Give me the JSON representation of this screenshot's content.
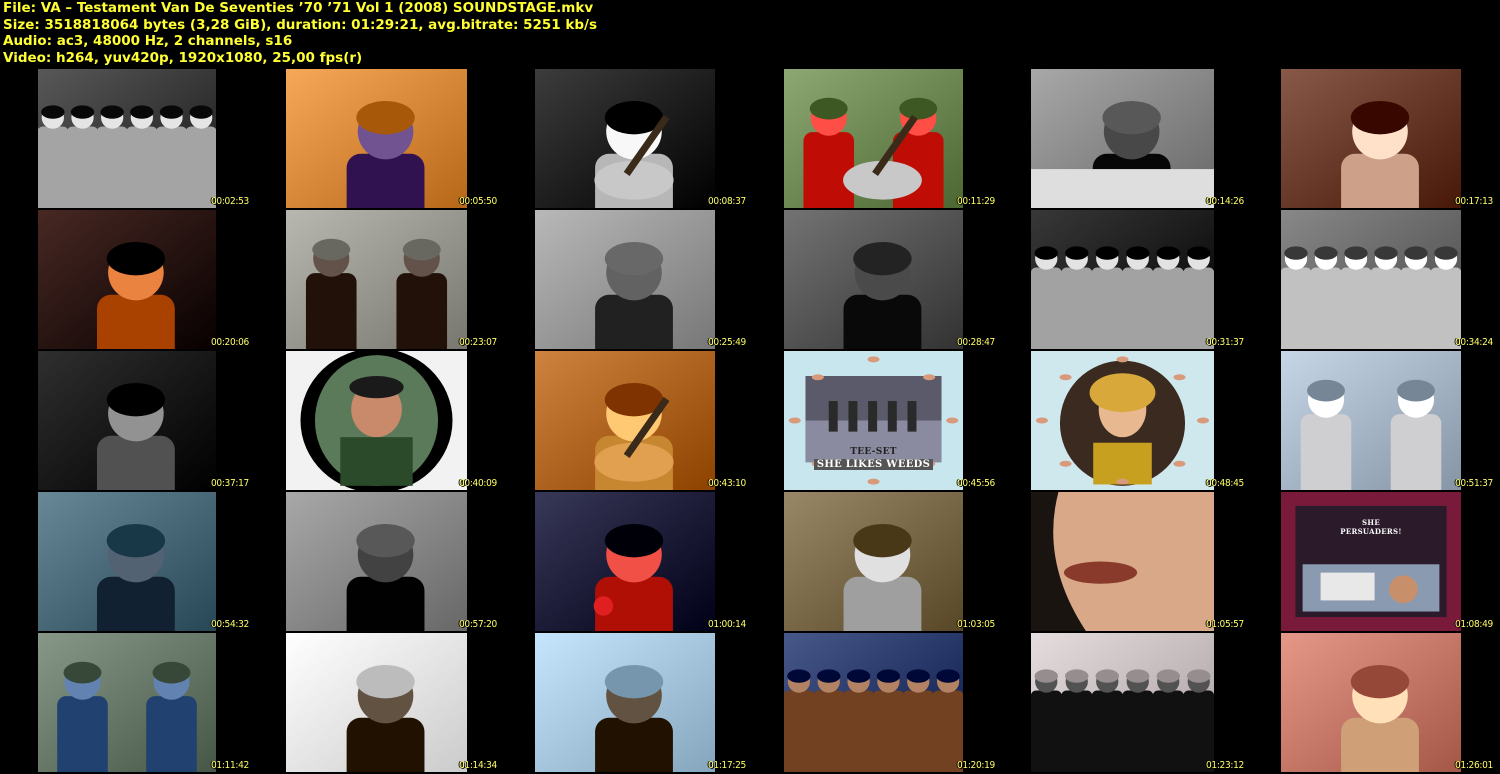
{
  "header": {
    "file_line": "File: VA – Testament Van De Seventies ’70 ’71 Vol 1 (2008) SOUNDSTAGE.mkv",
    "size_line": "Size: 3518818064 bytes (3,28 GiB), duration: 01:29:21, avg.bitrate: 5251 kb/s",
    "audio_line": "Audio: ac3, 48000 Hz, 2 channels, s16",
    "video_line": "Video: h264, yuv420p, 1920x1080, 25,00 fps(r)"
  },
  "thumbnails": [
    {
      "timestamp": "00:02:53",
      "bg": "#3a3a3a",
      "fg": "#bdbdbd",
      "kind": "dancers-bw"
    },
    {
      "timestamp": "00:05:50",
      "bg": "#d98a3a",
      "fg": "#4a2b6a",
      "kind": "organ-color"
    },
    {
      "timestamp": "00:08:37",
      "bg": "#1e1e1e",
      "fg": "#d0d0d0",
      "kind": "guitarist-bw"
    },
    {
      "timestamp": "00:11:29",
      "bg": "#6f8a55",
      "fg": "#d8261e",
      "kind": "duo-red"
    },
    {
      "timestamp": "00:14:26",
      "bg": "#8a8a8a",
      "fg": "#202020",
      "kind": "newsreader-bw"
    },
    {
      "timestamp": "00:17:13",
      "bg": "#6a3a2a",
      "fg": "#e6b9a2",
      "kind": "woman-color"
    },
    {
      "timestamp": "00:20:06",
      "bg": "#2a0a05",
      "fg": "#c25a18",
      "kind": "drummer-color"
    },
    {
      "timestamp": "00:23:07",
      "bg": "#9a9a92",
      "fg": "#3a2a22",
      "kind": "duo-street"
    },
    {
      "timestamp": "00:25:49",
      "bg": "#9a9a9a",
      "fg": "#3a3a3a",
      "kind": "harmonica-bw"
    },
    {
      "timestamp": "00:28:47",
      "bg": "#555555",
      "fg": "#222222",
      "kind": "arch-bw"
    },
    {
      "timestamp": "00:31:37",
      "bg": "#1a1a1a",
      "fg": "#bbbbbb",
      "kind": "crowd-dark"
    },
    {
      "timestamp": "00:34:24",
      "bg": "#6a6a6a",
      "fg": "#dadada",
      "kind": "crowd-bw"
    },
    {
      "timestamp": "00:37:17",
      "bg": "#111111",
      "fg": "#6a6a6a",
      "kind": "singer-dark"
    },
    {
      "timestamp": "00:40:09",
      "bg": "#f4f4f4",
      "fg": "#4a6a4a",
      "kind": "oval-portrait"
    },
    {
      "timestamp": "00:43:10",
      "bg": "#b06520",
      "fg": "#e0a04a",
      "kind": "acoustic-guitar"
    },
    {
      "timestamp": "00:45:56",
      "bg": "#c8e6ee",
      "fg": "#3a3a3a",
      "kind": "band-card",
      "caption_top": "TEE-SET",
      "caption_bottom": "SHE LIKES WEEDS"
    },
    {
      "timestamp": "00:48:45",
      "bg": "#cfe8ee",
      "fg": "#d9a83a",
      "kind": "circle-singer"
    },
    {
      "timestamp": "00:51:37",
      "bg": "#a8b8c8",
      "fg": "#e8e8ea",
      "kind": "sailors"
    },
    {
      "timestamp": "00:54:32",
      "bg": "#4a6a7a",
      "fg": "#2a3a4a",
      "kind": "water-boats"
    },
    {
      "timestamp": "00:57:20",
      "bg": "#8a8a8a",
      "fg": "#1a1a1a",
      "kind": "man-suit-bw"
    },
    {
      "timestamp": "01:00:14",
      "bg": "#1a1a3a",
      "fg": "#c8281e",
      "kind": "singer-mic-red"
    },
    {
      "timestamp": "01:03:05",
      "bg": "#7a6a4a",
      "fg": "#b8b8b8",
      "kind": "cart-woman"
    },
    {
      "timestamp": "01:05:57",
      "bg": "#e0d8c8",
      "fg": "#7a5a3a",
      "kind": "lips-closeup"
    },
    {
      "timestamp": "01:08:49",
      "bg": "#7a1a3a",
      "fg": "#d8d8d8",
      "kind": "persuaders",
      "caption_top": "SHE",
      "caption_bottom": "PERSUADERS!"
    },
    {
      "timestamp": "01:11:42",
      "bg": "#6a7a6a",
      "fg": "#3a5a8a",
      "kind": "kids"
    },
    {
      "timestamp": "01:14:34",
      "bg": "#eeeeee",
      "fg": "#3a2a1a",
      "kind": "man-white-bg"
    },
    {
      "timestamp": "01:17:25",
      "bg": "#a8c8e0",
      "fg": "#3a2a1a",
      "kind": "man-sky"
    },
    {
      "timestamp": "01:20:19",
      "bg": "#2a3a6a",
      "fg": "#8a5a3a",
      "kind": "dance-crowd"
    },
    {
      "timestamp": "01:23:12",
      "bg": "#c8c0c0",
      "fg": "#2a2a2a",
      "kind": "dancers-line"
    },
    {
      "timestamp": "01:26:01",
      "bg": "#c87a6a",
      "fg": "#e8b890",
      "kind": "woman-pink"
    }
  ]
}
